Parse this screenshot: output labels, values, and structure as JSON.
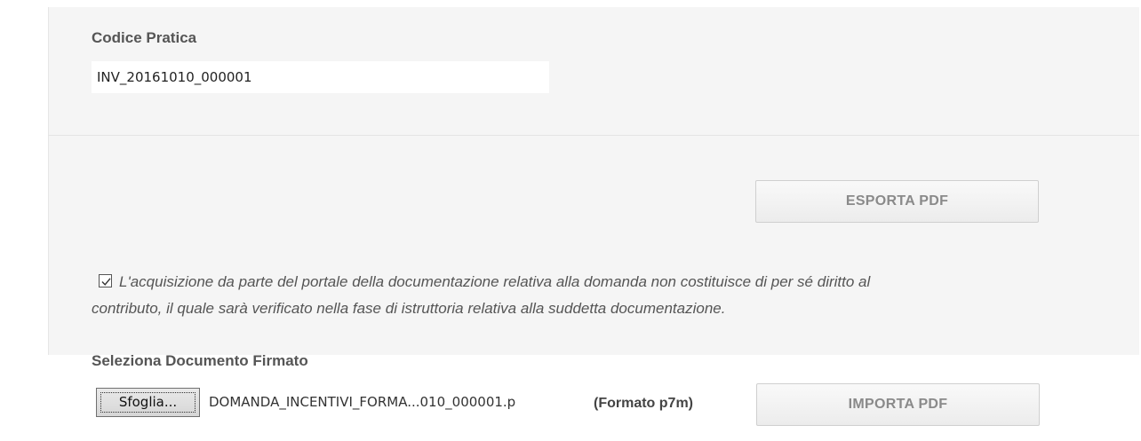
{
  "form": {
    "code_label": "Codice Pratica",
    "code_value": "INV_20161010_000001",
    "export_button": "ESPORTA PDF",
    "consent_checked": true,
    "consent_line1": "L'acquisizione da parte del portale della documentazione relativa alla domanda non costituisce di per sé diritto al",
    "consent_line2": "contributo, il quale sarà verificato nella fase di istruttoria relativa alla suddetta documentazione.",
    "doc_label": "Seleziona Documento Firmato",
    "browse_button": "Sfoglia...",
    "file_name": "DOMANDA_INCENTIVI_FORMA...010_000001.p",
    "format_note": "(Formato p7m)",
    "import_button": "IMPORTA PDF"
  },
  "icons": {
    "checkbox": "checkmark-icon"
  },
  "colors": {
    "panel_background": "#f5f5f5",
    "button_text": "#8a8a8a"
  }
}
